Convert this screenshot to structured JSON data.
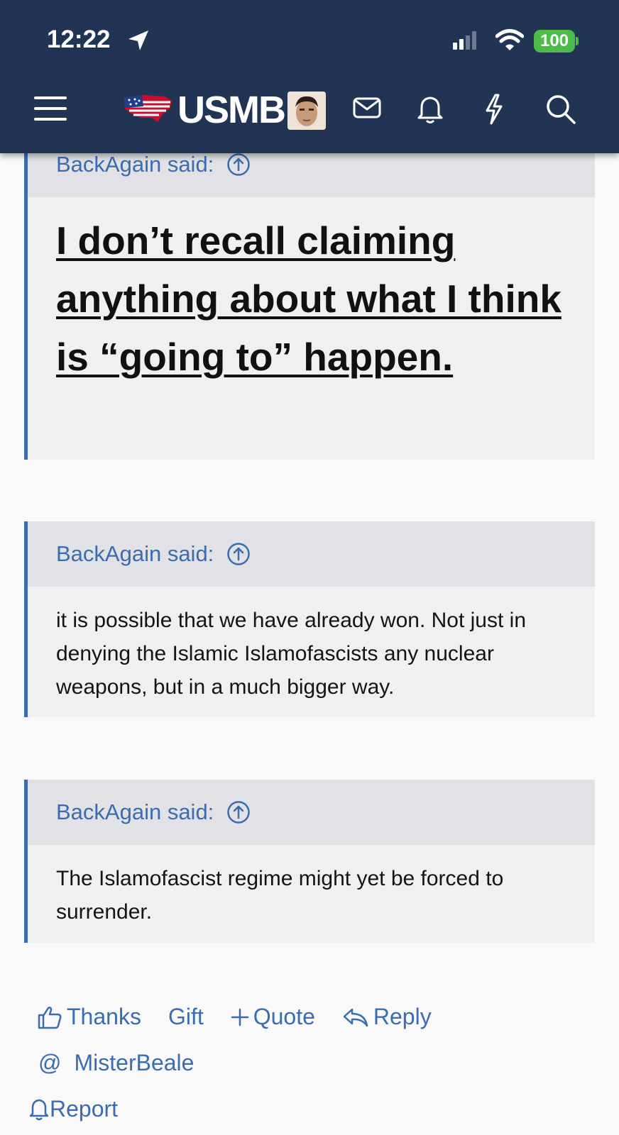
{
  "status_bar": {
    "time": "12:22",
    "battery": "100"
  },
  "nav": {
    "logo": "USMB"
  },
  "quotes": [
    {
      "author": "BackAgain said:",
      "text": "I don’t recall claiming anything about what I think is “going to” happen."
    },
    {
      "author": "BackAgain said:",
      "text": "it is possible that we have already won. Not just in denying the Islamic Islamofascists any nuclear weapons, but in a much bigger way."
    },
    {
      "author": "BackAgain said:",
      "text": "The Islamofascist regime might yet be forced to surrender."
    }
  ],
  "actions": {
    "thanks": "Thanks",
    "gift": "Gift",
    "quote": "Quote",
    "reply": "Reply",
    "mention": "MisterBeale",
    "report": "Report"
  },
  "colors": {
    "header_bg": "#213454",
    "accent": "#3b6cb0",
    "battery": "#4cbb4a"
  }
}
